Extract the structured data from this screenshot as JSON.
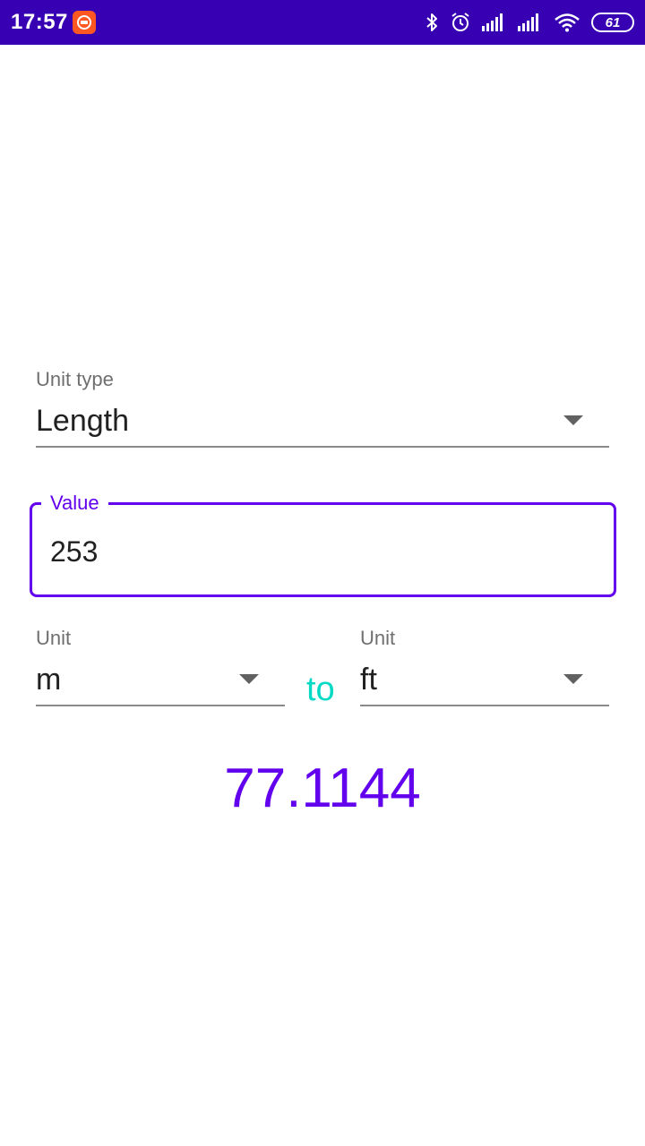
{
  "status_bar": {
    "time": "17:57",
    "battery": "61",
    "background_color": "#3700B3",
    "icons": [
      "app-notification-icon",
      "bluetooth-icon",
      "alarm-icon",
      "signal-icon",
      "signal-icon",
      "wifi-icon",
      "battery-icon"
    ]
  },
  "unit_type": {
    "label": "Unit type",
    "value": "Length"
  },
  "value_field": {
    "label": "Value",
    "value": "253"
  },
  "from_unit": {
    "label": "Unit",
    "value": "m"
  },
  "connector": "to",
  "to_unit": {
    "label": "Unit",
    "value": "ft"
  },
  "result": "77.1144",
  "colors": {
    "primary": "#6200EE",
    "primary_dark": "#3700B3",
    "secondary": "#03DAC5"
  }
}
